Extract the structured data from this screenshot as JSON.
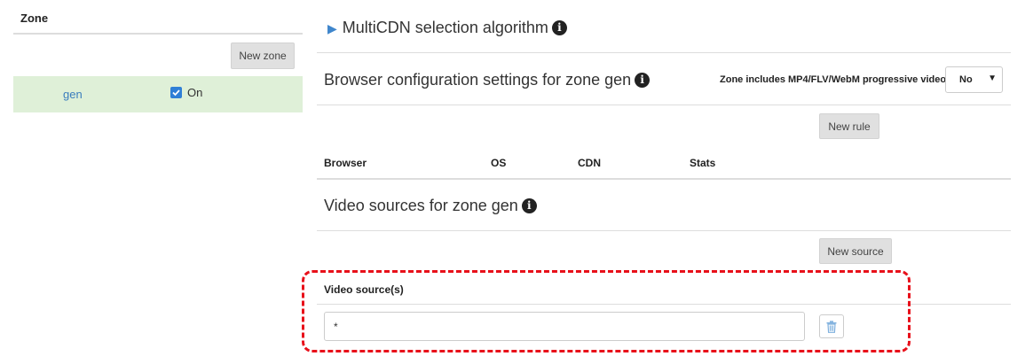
{
  "zones_panel": {
    "header": "Zone",
    "new_zone_label": "New zone",
    "zones": [
      {
        "name": "gen",
        "enabled": true,
        "enabled_label": "On"
      }
    ]
  },
  "multicdn": {
    "title": "MultiCDN selection algorithm",
    "expand_icon": "triangle-right-icon",
    "info_icon": "info-icon"
  },
  "browser_config": {
    "title": "Browser configuration settings for zone gen",
    "progressive_label": "Zone includes MP4/FLV/WebM progressive videos",
    "progressive_value": "No",
    "new_rule_label": "New rule",
    "columns": [
      "Browser",
      "OS",
      "CDN",
      "Stats"
    ]
  },
  "video_sources": {
    "title": "Video sources for zone gen",
    "new_source_label": "New source",
    "column_header": "Video source(s)",
    "rows": [
      {
        "value": "*"
      }
    ]
  },
  "colors": {
    "zone_row_bg": "#dff0d8",
    "link": "#3a7dbd",
    "highlight": "#e8101a"
  }
}
